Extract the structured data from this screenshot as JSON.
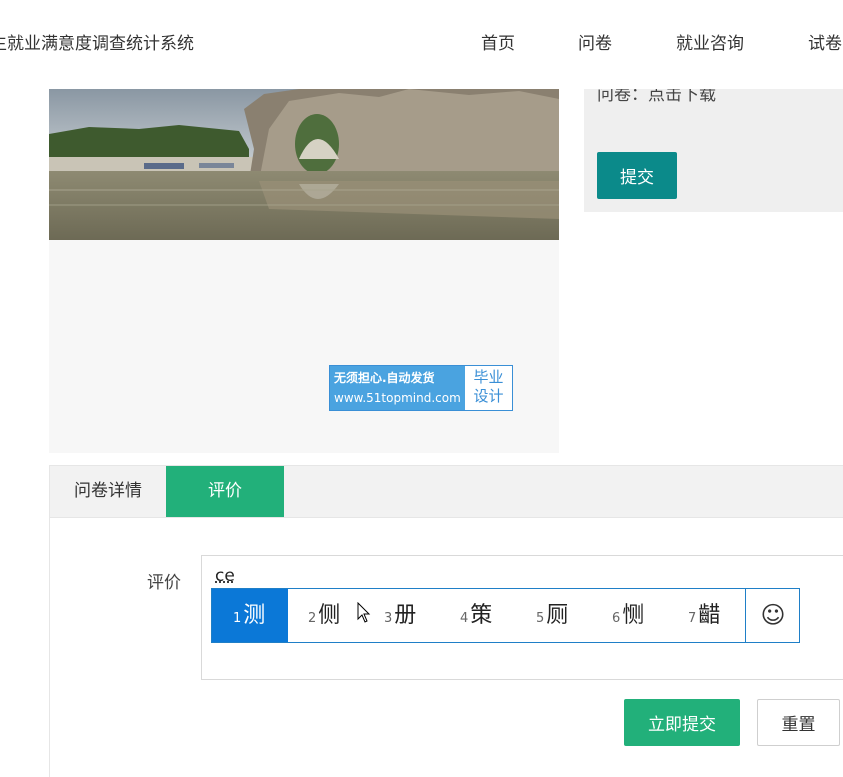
{
  "header": {
    "site_title": "生就业满意度调查统计系统",
    "nav": [
      "首页",
      "问卷",
      "就业咨询",
      "试卷"
    ]
  },
  "badge": {
    "line1": "无须担心.自动发货",
    "line2": "www.51topmind.com",
    "right1": "毕业",
    "right2": "设计"
  },
  "info": {
    "text": "问卷：点击下载",
    "submit_label": "提交"
  },
  "tabs": [
    "问卷详情",
    "评价"
  ],
  "form": {
    "label": "评价",
    "value": "ce",
    "submit_label": "立即提交",
    "reset_label": "重置"
  },
  "ime": {
    "candidates": [
      {
        "num": "1",
        "text": "测"
      },
      {
        "num": "2",
        "text": "侧"
      },
      {
        "num": "3",
        "text": "册"
      },
      {
        "num": "4",
        "text": "策"
      },
      {
        "num": "5",
        "text": "厕"
      },
      {
        "num": "6",
        "text": "恻"
      },
      {
        "num": "7",
        "text": "齰"
      }
    ],
    "emoji": "☺"
  }
}
